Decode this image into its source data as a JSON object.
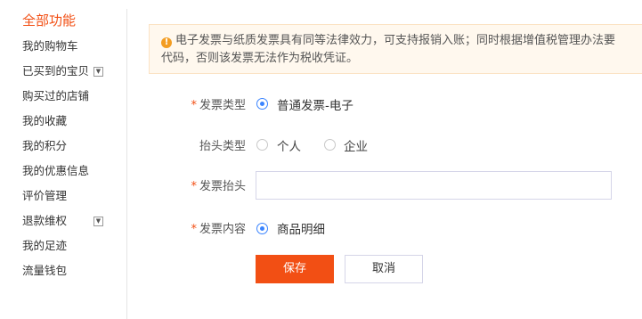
{
  "sidebar": {
    "title": "全部功能",
    "items": [
      {
        "label": "我的购物车"
      },
      {
        "label": "已买到的宝贝",
        "toggle": "▼"
      },
      {
        "label": "购买过的店铺"
      },
      {
        "label": "我的收藏"
      },
      {
        "label": "我的积分"
      },
      {
        "label": "我的优惠信息"
      },
      {
        "label": "评价管理"
      },
      {
        "label": "退款维权",
        "toggle": "▼"
      },
      {
        "label": "我的足迹"
      },
      {
        "label": "流量钱包"
      }
    ]
  },
  "notice": {
    "icon": "!",
    "line1": "电子发票与纸质发票具有同等法律效力，可支持报销入账；同时根据增值税管理办法要",
    "line2": "代码，否则该发票无法作为税收凭证。"
  },
  "form": {
    "required_mark": "*",
    "invoice_type": {
      "label": "发票类型",
      "option": "普通发票-电子"
    },
    "header_type": {
      "label": "抬头类型",
      "options": [
        "个人",
        "企业"
      ]
    },
    "invoice_header": {
      "label": "发票抬头",
      "value": "",
      "placeholder": ""
    },
    "invoice_content": {
      "label": "发票内容",
      "option": "商品明细"
    }
  },
  "buttons": {
    "save": "保存",
    "cancel": "取消"
  },
  "colors": {
    "accent": "#f24f14",
    "radio": "#3a84ff",
    "notice_bg": "#fff8ee",
    "notice_icon": "#f39d22"
  }
}
